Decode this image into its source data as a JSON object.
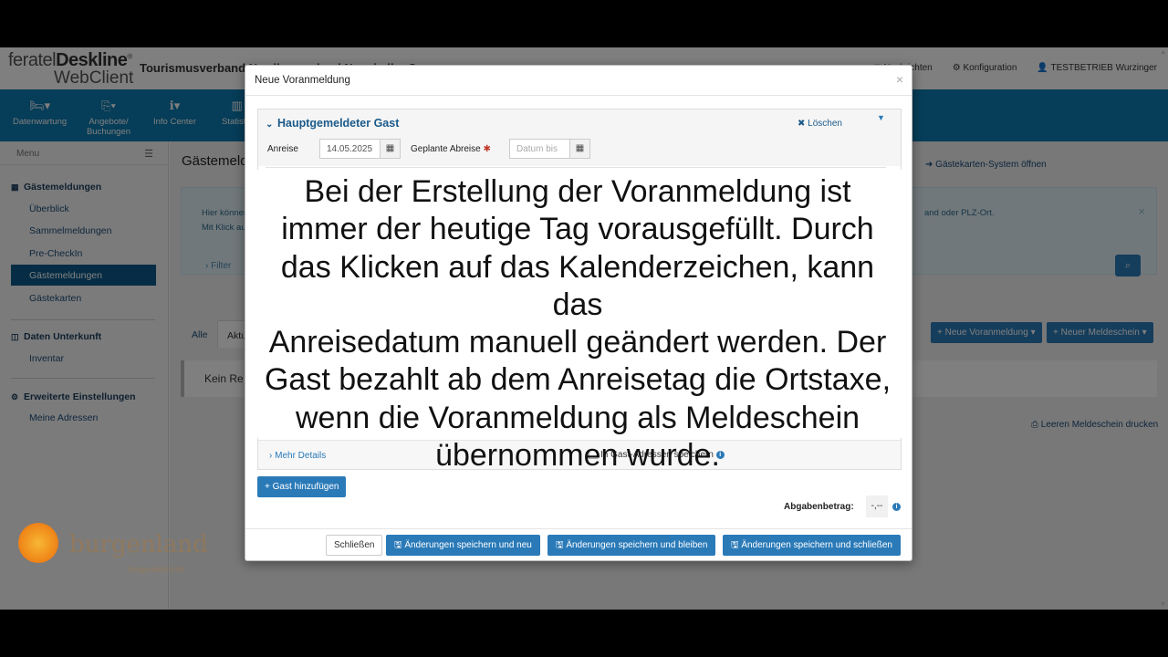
{
  "brand": {
    "logo_line1_a": "feratel",
    "logo_line1_b": "Deskline",
    "logo_reg": "®",
    "logo_line2": "WebClient",
    "org": "Tourismusverband Nordburgenland Neusiedler See"
  },
  "toplinks": {
    "nachrichten": "Nachrichten",
    "konfiguration": "Konfiguration",
    "user": "TESTBETRIEB Wurzinger"
  },
  "nav": [
    {
      "label": "Datenwartung"
    },
    {
      "label": "Angebote/ Buchungen"
    },
    {
      "label": "Info Center"
    },
    {
      "label": "Statistik"
    }
  ],
  "sidebar": {
    "menu": "Menu",
    "group1": "Gästemeldungen",
    "items1": [
      "Überblick",
      "Sammelmeldungen",
      "Pre-CheckIn",
      "Gästemeldungen",
      "Gästekarten"
    ],
    "group2": "Daten Unterkunft",
    "items2": [
      "Inventar"
    ],
    "group3": "Erweiterte Einstellungen",
    "items3": [
      "Meine Adressen"
    ]
  },
  "main": {
    "title": "Gästemeldungen",
    "gk_link": "Gästekarten-System öffnen",
    "info_line1": "Hier können",
    "info_line2": "Mit Klick au",
    "info_right": "and oder PLZ-Ort.",
    "filter": "Filter",
    "tab_all": "Alle",
    "tab_akt": "Aktu",
    "btn_neue_voranmeldung": "Neue Voranmeldung",
    "btn_neuer_meldeschein": "Neuer Meldeschein",
    "kein": "Kein Re",
    "leeren": "Leeren Meldeschein drucken"
  },
  "watermark": {
    "text": "burgenland",
    "sub": "burgenland.info"
  },
  "modal": {
    "title": "Neue Voranmeldung",
    "close": "×",
    "section_title": "Hauptgemeldeter Gast",
    "delete": "Löschen",
    "anreise_label": "Anreise",
    "anreise_value": "14.05.2025",
    "abreise_label": "Geplante Abreise",
    "abreise_placeholder": "Datum bis",
    "mehr_details": "Mehr Details",
    "save_checkbox": "In Gast-Adressen speichern",
    "add_guest": "Gast hinzufügen",
    "abgabe_label": "Abgabenbetrag:",
    "abgabe_value": "-,--",
    "btn_close": "Schließen",
    "btn_save_new": "Änderungen speichern und neu",
    "btn_save_stay": "Änderungen speichern und bleiben",
    "btn_save_close": "Änderungen speichern und schließen"
  },
  "caption": {
    "lines": [
      "Bei der Erstellung der Voranmeldung ist",
      "immer der heutige Tag vorausgefüllt. Durch",
      "das Klicken auf das Kalenderzeichen, kann das",
      "Anreisedatum manuell geändert werden. Der",
      "Gast bezahlt ab dem Anreisetag die Ortstaxe,",
      "wenn die Voranmeldung als Meldeschein",
      "übernommen wurde."
    ]
  },
  "colors": {
    "nav": "#0d7ab1",
    "primary": "#2a7ab8",
    "active_sidebar": "#0d5a8a"
  }
}
